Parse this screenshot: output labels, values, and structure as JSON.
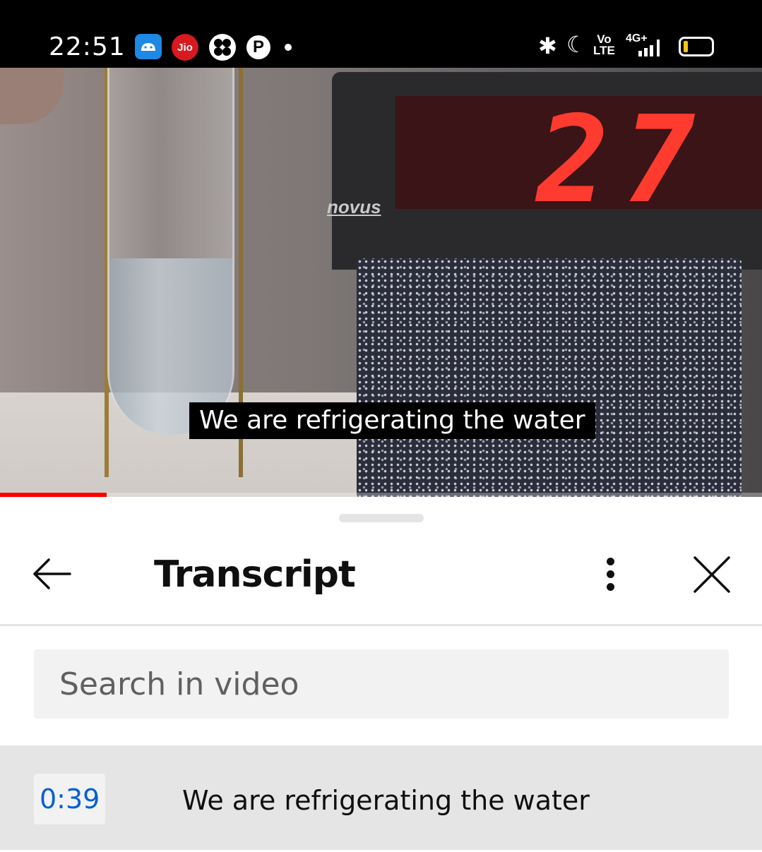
{
  "status_bar": {
    "time": "22:51",
    "jio_label": "Jio",
    "pinterest_glyph": "P",
    "bluetooth_glyph": "✱",
    "moon_glyph": "☾",
    "volte_top": "Vo",
    "volte_bottom": "LTE",
    "network": "4G+",
    "icons": [
      "android-icon",
      "jio-icon",
      "fan-icon",
      "pinterest-icon",
      "notification-dot",
      "bluetooth-icon",
      "do-not-disturb-icon",
      "volte-icon",
      "signal-icon",
      "battery-icon"
    ],
    "battery_color": "#f5c518"
  },
  "video": {
    "display_reading": "27",
    "brand": "novus",
    "caption": "We are refrigerating the water",
    "progress_fraction": 0.14,
    "progress_color": "#ff0000"
  },
  "sheet": {
    "title": "Transcript",
    "search_placeholder": "Search in video",
    "segments": [
      {
        "time": "0:39",
        "text": "We are refrigerating the water"
      }
    ],
    "timestamp_color": "#065fd4"
  }
}
